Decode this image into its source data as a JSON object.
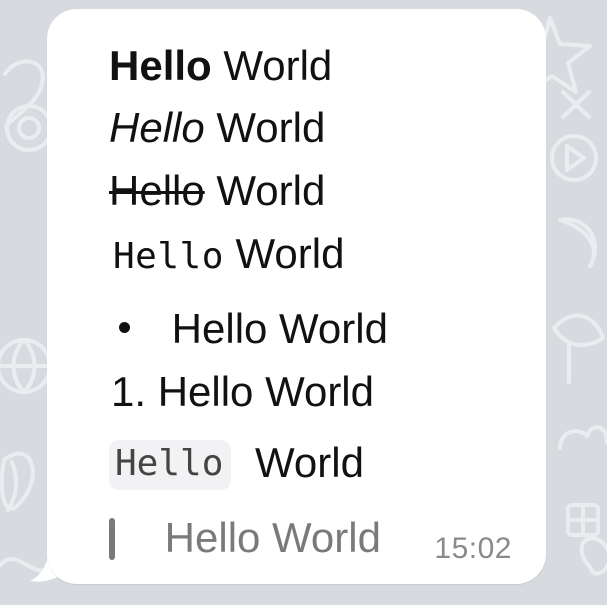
{
  "message": {
    "bold_line": {
      "formatted": "Hello",
      "plain": "World"
    },
    "italic_line": {
      "formatted": "Hello",
      "plain": "World"
    },
    "strikethrough_line": {
      "formatted": "Hello",
      "plain": "World"
    },
    "monospace_line": {
      "formatted": "Hello",
      "plain": "World"
    },
    "bullet_line": {
      "text": "Hello World"
    },
    "numbered_line": {
      "marker": "1.",
      "text": "Hello World"
    },
    "inline_code_line": {
      "formatted": "Hello",
      "plain": "World"
    },
    "quote_line": {
      "text": "Hello World"
    },
    "timestamp": "15:02"
  },
  "colors": {
    "background": "#d7dbe0",
    "bubble": "#ffffff",
    "text": "#111111",
    "muted": "#7a7a7a",
    "code_background": "#f2f2f4"
  },
  "icons": {
    "background_doodles": "chat-wallpaper-doodle-icons"
  }
}
